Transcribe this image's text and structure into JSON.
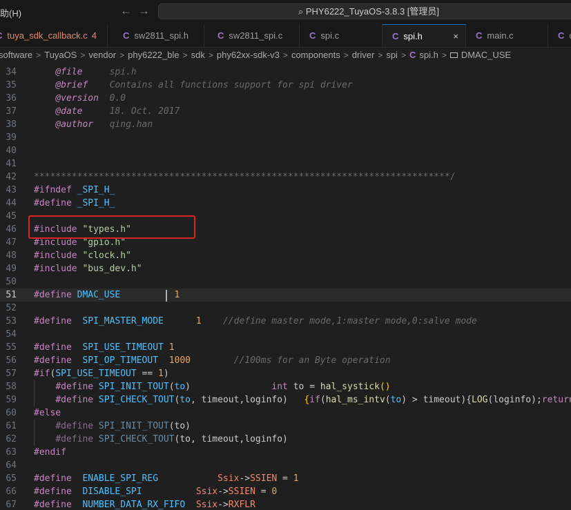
{
  "titlebar": {
    "menu_label": "助(H)",
    "back_icon": "arrow-left-icon",
    "forward_icon": "arrow-right-icon",
    "command_center": "PHY6222_TuyaOS-3.8.3 [管理员]",
    "search_icon": "search-icon"
  },
  "tabs": [
    {
      "label": "tuya_sdk_callback.c",
      "badge": "4",
      "modified": true
    },
    {
      "label": "sw2811_spi.h"
    },
    {
      "label": "sw2811_spi.c"
    },
    {
      "label": "spi.c"
    },
    {
      "label": "spi.h",
      "active": true,
      "close": "×"
    },
    {
      "label": "main.c"
    },
    {
      "label": "c"
    }
  ],
  "tab_icon_glyph": "C",
  "breadcrumb": {
    "parts": [
      "software",
      "TuyaOS",
      "vendor",
      "phy6222_ble",
      "sdk",
      "phy62xx-sdk-v3",
      "components",
      "driver",
      "spi"
    ],
    "file": "spi.h",
    "symbol": "DMAC_USE",
    "separator": ">"
  },
  "editor": {
    "current_line": 51,
    "colors": {
      "background": "#1f1f1f",
      "keyword": "#c586c0",
      "macro": "#4fc1ff",
      "number": "#e2a86a",
      "string": "#ce9178",
      "comment": "#6a6a6a",
      "highlight_box": "#e02424"
    },
    "lines": [
      {
        "n": "34",
        "t": [
          [
            "    ",
            "plain"
          ],
          [
            "@file",
            "doc"
          ],
          [
            "     spi.h",
            "docv"
          ]
        ]
      },
      {
        "n": "35",
        "t": [
          [
            "    ",
            "plain"
          ],
          [
            "@brief",
            "doc"
          ],
          [
            "    Contains all functions support for spi driver",
            "docv"
          ]
        ]
      },
      {
        "n": "36",
        "t": [
          [
            "    ",
            "plain"
          ],
          [
            "@version",
            "doc"
          ],
          [
            "  0.0",
            "docv"
          ]
        ]
      },
      {
        "n": "37",
        "t": [
          [
            "    ",
            "plain"
          ],
          [
            "@date",
            "doc"
          ],
          [
            "     18. Oct. 2017",
            "docv"
          ]
        ]
      },
      {
        "n": "38",
        "t": [
          [
            "    ",
            "plain"
          ],
          [
            "@author",
            "doc"
          ],
          [
            "   qing.han",
            "docv"
          ]
        ]
      },
      {
        "n": "39",
        "t": []
      },
      {
        "n": "40",
        "t": []
      },
      {
        "n": "41",
        "t": []
      },
      {
        "n": "42",
        "t": [
          [
            "*****************************************************************************/",
            "star"
          ]
        ]
      },
      {
        "n": "43",
        "t": [
          [
            "#ifndef",
            "dir"
          ],
          [
            " _SPI_H_",
            "mac"
          ]
        ]
      },
      {
        "n": "44",
        "t": [
          [
            "#define",
            "dir"
          ],
          [
            " _SPI_H_",
            "mac"
          ]
        ]
      },
      {
        "n": "45",
        "t": []
      },
      {
        "n": "46",
        "t": [
          [
            "#include",
            "dir"
          ],
          [
            " \"types.h\"",
            "str2"
          ]
        ]
      },
      {
        "n": "47",
        "t": [
          [
            "#include",
            "dir"
          ],
          [
            " \"gpio.h\"",
            "str2"
          ]
        ]
      },
      {
        "n": "48",
        "t": [
          [
            "#include",
            "dir"
          ],
          [
            " \"clock.h\"",
            "str2"
          ]
        ]
      },
      {
        "n": "49",
        "t": [
          [
            "#include",
            "dir"
          ],
          [
            " \"bus_dev.h\"",
            "str2"
          ]
        ]
      },
      {
        "n": "50",
        "t": []
      },
      {
        "n": "51",
        "t": [
          [
            "#define",
            "dir"
          ],
          [
            " DMAC_USE",
            "mac"
          ],
          [
            "          ",
            "plain"
          ],
          [
            "1",
            "num"
          ]
        ]
      },
      {
        "n": "52",
        "t": []
      },
      {
        "n": "53",
        "t": [
          [
            "#define",
            "dir"
          ],
          [
            "  SPI_MASTER_MODE",
            "mac"
          ],
          [
            "      ",
            "plain"
          ],
          [
            "1",
            "num"
          ],
          [
            "    //define master mode,1:master mode,0:salve mode",
            "com"
          ]
        ]
      },
      {
        "n": "54",
        "t": []
      },
      {
        "n": "55",
        "t": [
          [
            "#define",
            "dir"
          ],
          [
            "  SPI_USE_TIMEOUT",
            "mac"
          ],
          [
            " ",
            "plain"
          ],
          [
            "1",
            "num"
          ]
        ]
      },
      {
        "n": "56",
        "t": [
          [
            "#define",
            "dir"
          ],
          [
            "  SPI_OP_TIMEOUT",
            "mac"
          ],
          [
            "  ",
            "plain"
          ],
          [
            "1000",
            "num"
          ],
          [
            "        //100ms for an Byte operation",
            "com"
          ]
        ]
      },
      {
        "n": "57",
        "t": [
          [
            "#if",
            "dir"
          ],
          [
            "(",
            "plain"
          ],
          [
            "SPI_USE_TIMEOUT",
            "mac"
          ],
          [
            " == ",
            "plain"
          ],
          [
            "1",
            "num"
          ],
          [
            ")",
            "plain"
          ]
        ]
      },
      {
        "n": "58",
        "t": [
          [
            "    ",
            "plain"
          ],
          [
            "#define",
            "dir"
          ],
          [
            " SPI_INIT_TOUT",
            "mac"
          ],
          [
            "(",
            "plain"
          ],
          [
            "to",
            "mac"
          ],
          [
            ")",
            "plain"
          ],
          [
            "               ",
            "plain"
          ],
          [
            "int",
            "kw"
          ],
          [
            " to = ",
            "plain"
          ],
          [
            "hal_systick",
            "fn"
          ],
          [
            "()",
            "brk"
          ]
        ]
      },
      {
        "n": "59",
        "t": [
          [
            "    ",
            "plain"
          ],
          [
            "#define",
            "dir"
          ],
          [
            " SPI_CHECK_TOUT",
            "mac"
          ],
          [
            "(",
            "plain"
          ],
          [
            "to",
            "mac"
          ],
          [
            ", timeout,loginfo)   ",
            "plain"
          ],
          [
            "{",
            "brk"
          ],
          [
            "if",
            "kw"
          ],
          [
            "(",
            "plain"
          ],
          [
            "hal_ms_intv",
            "fn"
          ],
          [
            "(",
            "plain"
          ],
          [
            "to",
            "mac"
          ],
          [
            ") > timeout)",
            "plain"
          ],
          [
            "{",
            "plain"
          ],
          [
            "LOG",
            "fn"
          ],
          [
            "(loginfo);",
            "plain"
          ],
          [
            "return",
            "kw"
          ]
        ]
      },
      {
        "n": "60",
        "t": [
          [
            "#else",
            "dir"
          ]
        ]
      },
      {
        "n": "61",
        "t": [
          [
            "    ",
            "plain"
          ],
          [
            "#define",
            "dim"
          ],
          [
            " SPI_INIT_TOUT",
            "dimm"
          ],
          [
            "(to)",
            "plain"
          ]
        ]
      },
      {
        "n": "62",
        "t": [
          [
            "    ",
            "plain"
          ],
          [
            "#define",
            "dim"
          ],
          [
            " SPI_CHECK_TOUT",
            "dimm"
          ],
          [
            "(to, timeout,loginfo)",
            "plain"
          ]
        ]
      },
      {
        "n": "63",
        "t": [
          [
            "#endif",
            "dir"
          ]
        ]
      },
      {
        "n": "64",
        "t": []
      },
      {
        "n": "65",
        "t": [
          [
            "#define",
            "dir"
          ],
          [
            "  ENABLE_SPI_REG",
            "mac"
          ],
          [
            "           ",
            "plain"
          ],
          [
            "Ssix",
            "red"
          ],
          [
            "->",
            "plain"
          ],
          [
            "SSIEN",
            "red"
          ],
          [
            " = ",
            "plain"
          ],
          [
            "1",
            "num"
          ]
        ]
      },
      {
        "n": "66",
        "t": [
          [
            "#define",
            "dir"
          ],
          [
            "  DISABLE_SPI",
            "mac"
          ],
          [
            "          ",
            "plain"
          ],
          [
            "Ssix",
            "red"
          ],
          [
            "->",
            "plain"
          ],
          [
            "SSIEN",
            "red"
          ],
          [
            " = ",
            "plain"
          ],
          [
            "0",
            "num"
          ]
        ]
      },
      {
        "n": "67",
        "t": [
          [
            "#define",
            "dir"
          ],
          [
            "  NUMBER_DATA_RX_FIFO",
            "mac"
          ],
          [
            "  ",
            "plain"
          ],
          [
            "Ssix",
            "red"
          ],
          [
            "->",
            "plain"
          ],
          [
            "RXFLR",
            "red"
          ]
        ]
      }
    ]
  }
}
